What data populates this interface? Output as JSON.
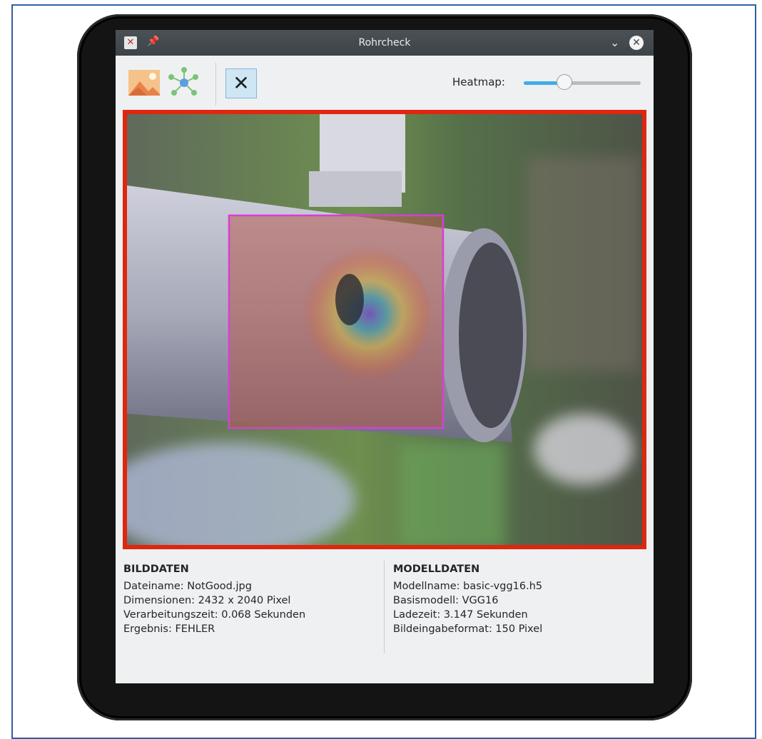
{
  "window": {
    "title": "Rohrcheck"
  },
  "toolbar": {
    "buttons": [
      {
        "name": "open-image",
        "icon": "image-icon"
      },
      {
        "name": "network",
        "icon": "network-icon"
      },
      {
        "name": "close-image",
        "icon": "close-icon"
      }
    ],
    "heatmap_label": "Heatmap:",
    "heatmap_value": 0.35
  },
  "image": {
    "status_color": "#e0260e",
    "highlight_color": "#d63fd6"
  },
  "bilddaten": {
    "heading": "BILDDATEN",
    "lines": [
      "Dateiname: NotGood.jpg",
      "Dimensionen: 2432 x 2040 Pixel",
      "Verarbeitungszeit: 0.068 Sekunden",
      "Ergebnis: FEHLER"
    ]
  },
  "modelldaten": {
    "heading": "MODELLDATEN",
    "lines": [
      "Modellname: basic-vgg16.h5",
      "Basismodell: VGG16",
      "Ladezeit: 3.147 Sekunden",
      "Bildeingabeformat: 150 Pixel"
    ]
  }
}
